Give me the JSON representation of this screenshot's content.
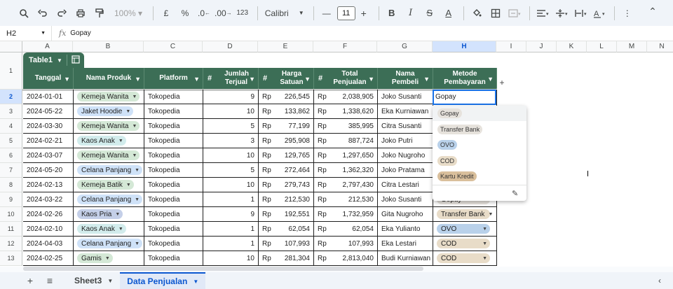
{
  "toolbar": {
    "zoom": "100%",
    "currency": "£",
    "percent": "%",
    "decrease_decimals": ".0",
    "increase_decimals": ".00",
    "number_format": "123",
    "font": "Calibri",
    "font_size": "11"
  },
  "formula_bar": {
    "cell_ref": "H2",
    "fx": "fx",
    "value": "Gopay"
  },
  "columns": [
    "A",
    "B",
    "C",
    "D",
    "E",
    "F",
    "G",
    "H",
    "I",
    "J",
    "K",
    "L",
    "M",
    "N"
  ],
  "table_name": "Table1",
  "headers": {
    "tanggal": "Tanggal",
    "nama_produk": "Nama Produk",
    "platform": "Platform",
    "jumlah_terjual": "Jumlah Terjual",
    "harga_satuan": "Harga Satuan",
    "total_penjualan": "Total Penjualan",
    "nama_pembeli": "Nama Pembeli",
    "metode_pembayaran": "Metode Pembayaran"
  },
  "row_numbers": [
    "1",
    "2",
    "3",
    "4",
    "5",
    "6",
    "7",
    "8",
    "9",
    "10",
    "11",
    "12",
    "13"
  ],
  "rows": [
    {
      "tanggal": "2024-01-01",
      "produk": "Kemeja Wanita",
      "produk_color": "green",
      "platform": "Tokopedia",
      "jumlah": "9",
      "cur1": "Rp",
      "harga": "226,545",
      "cur2": "Rp",
      "total": "2,038,905",
      "pembeli": "Joko Susanti",
      "metode": "",
      "metode_color": ""
    },
    {
      "tanggal": "2024-05-22",
      "produk": "Jaket Hoodie",
      "produk_color": "blue",
      "platform": "Tokopedia",
      "jumlah": "10",
      "cur1": "Rp",
      "harga": "133,862",
      "cur2": "Rp",
      "total": "1,338,620",
      "pembeli": "Eka Kurniawan",
      "metode": "",
      "metode_color": ""
    },
    {
      "tanggal": "2024-03-30",
      "produk": "Kemeja Wanita",
      "produk_color": "green",
      "platform": "Tokopedia",
      "jumlah": "5",
      "cur1": "Rp",
      "harga": "77,199",
      "cur2": "Rp",
      "total": "385,995",
      "pembeli": "Citra Susanti",
      "metode": "",
      "metode_color": ""
    },
    {
      "tanggal": "2024-02-21",
      "produk": "Kaos Anak",
      "produk_color": "teal",
      "platform": "Tokopedia",
      "jumlah": "3",
      "cur1": "Rp",
      "harga": "295,908",
      "cur2": "Rp",
      "total": "887,724",
      "pembeli": "Joko Putri",
      "metode": "",
      "metode_color": ""
    },
    {
      "tanggal": "2024-03-07",
      "produk": "Kemeja Wanita",
      "produk_color": "green",
      "platform": "Tokopedia",
      "jumlah": "10",
      "cur1": "Rp",
      "harga": "129,765",
      "cur2": "Rp",
      "total": "1,297,650",
      "pembeli": "Joko Nugroho",
      "metode": "",
      "metode_color": ""
    },
    {
      "tanggal": "2024-05-20",
      "produk": "Celana Panjang",
      "produk_color": "blue",
      "platform": "Tokopedia",
      "jumlah": "5",
      "cur1": "Rp",
      "harga": "272,464",
      "cur2": "Rp",
      "total": "1,362,320",
      "pembeli": "Joko Pratama",
      "metode": "",
      "metode_color": ""
    },
    {
      "tanggal": "2024-02-13",
      "produk": "Kemeja Batik",
      "produk_color": "green",
      "platform": "Tokopedia",
      "jumlah": "10",
      "cur1": "Rp",
      "harga": "279,743",
      "cur2": "Rp",
      "total": "2,797,430",
      "pembeli": "Citra Lestari",
      "metode": "",
      "metode_color": ""
    },
    {
      "tanggal": "2024-03-22",
      "produk": "Celana Panjang",
      "produk_color": "blue",
      "platform": "Tokopedia",
      "jumlah": "1",
      "cur1": "Rp",
      "harga": "212,530",
      "cur2": "Rp",
      "total": "212,530",
      "pembeli": "Joko Susanti",
      "metode": "Gopay",
      "metode_color": "gray"
    },
    {
      "tanggal": "2024-02-26",
      "produk": "Kaos Pria",
      "produk_color": "indigo",
      "platform": "Tokopedia",
      "jumlah": "9",
      "cur1": "Rp",
      "harga": "192,551",
      "cur2": "Rp",
      "total": "1,732,959",
      "pembeli": "Gita Nugroho",
      "metode": "Transfer Bank",
      "metode_color": "tan"
    },
    {
      "tanggal": "2024-02-10",
      "produk": "Kaos Anak",
      "produk_color": "teal",
      "platform": "Tokopedia",
      "jumlah": "1",
      "cur1": "Rp",
      "harga": "62,054",
      "cur2": "Rp",
      "total": "62,054",
      "pembeli": "Eka Yulianto",
      "metode": "OVO",
      "metode_color": "steel"
    },
    {
      "tanggal": "2024-04-03",
      "produk": "Celana Panjang",
      "produk_color": "blue",
      "platform": "Tokopedia",
      "jumlah": "1",
      "cur1": "Rp",
      "harga": "107,993",
      "cur2": "Rp",
      "total": "107,993",
      "pembeli": "Eka Lestari",
      "metode": "COD",
      "metode_color": "tan"
    },
    {
      "tanggal": "2024-02-25",
      "produk": "Gamis",
      "produk_color": "green",
      "platform": "Tokopedia",
      "jumlah": "10",
      "cur1": "Rp",
      "harga": "281,304",
      "cur2": "Rp",
      "total": "2,813,040",
      "pembeli": "Budi Kurniawan",
      "metode": "COD",
      "metode_color": "tan"
    }
  ],
  "active_cell_value": "Gopay",
  "dropdown": {
    "options": [
      {
        "label": "Gopay",
        "color": "gray"
      },
      {
        "label": "Transfer Bank",
        "color": "gray"
      },
      {
        "label": "OVO",
        "color": "steel"
      },
      {
        "label": "COD",
        "color": "tan"
      },
      {
        "label": "Kartu Kredit",
        "color": "dtan"
      }
    ]
  },
  "sheets": {
    "tabs": [
      {
        "label": "Sheet3",
        "active": false
      },
      {
        "label": "Data Penjualan",
        "active": true
      }
    ]
  },
  "colors": {
    "table_header": "#3c6e56",
    "selection": "#1a73e8"
  }
}
